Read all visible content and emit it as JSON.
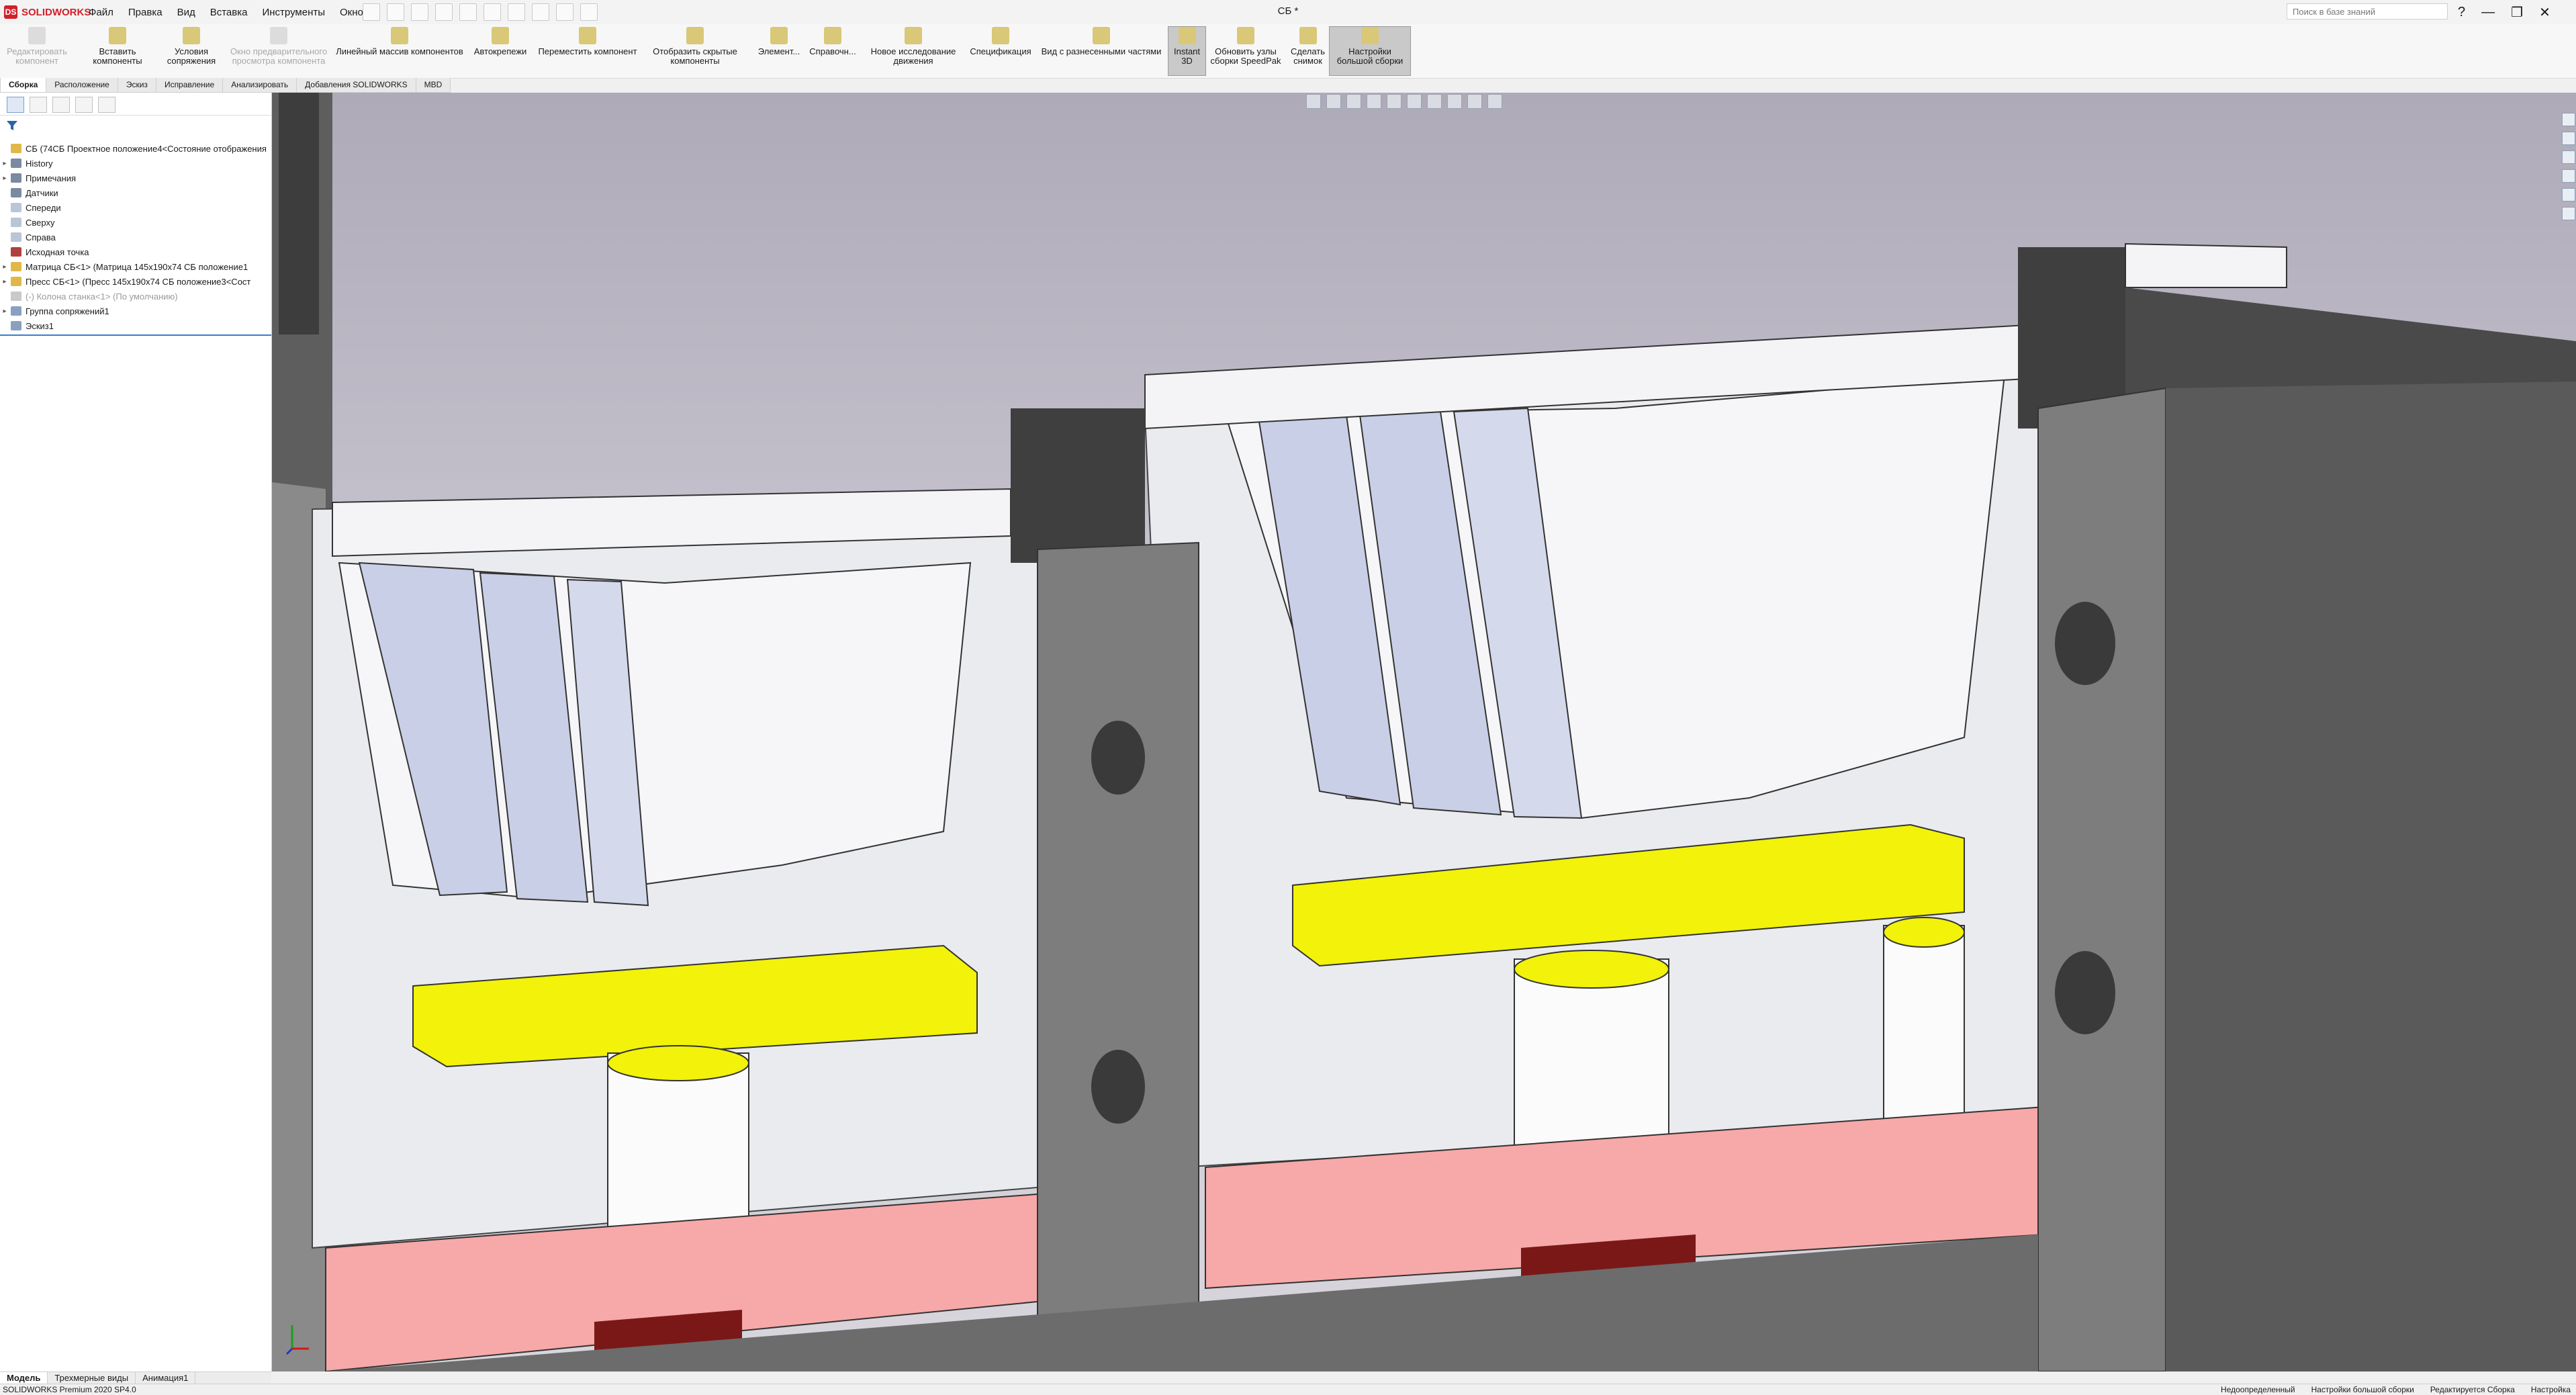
{
  "app": {
    "logo_text": "SOLIDWORKS",
    "doc_title": "СБ *"
  },
  "menu": [
    "Файл",
    "Правка",
    "Вид",
    "Вставка",
    "Инструменты",
    "Окно"
  ],
  "search": {
    "placeholder": "Поиск в базе знаний"
  },
  "window_controls": [
    "?",
    "—",
    "❐",
    "✕"
  ],
  "toolbar": [
    {
      "label": "Редактировать компонент",
      "state": "disabled",
      "icon": "edit-component-icon"
    },
    {
      "label": "Вставить компоненты",
      "state": "normal",
      "icon": "insert-components-icon"
    },
    {
      "label": "Условия сопряжения",
      "state": "normal",
      "icon": "mate-icon"
    },
    {
      "label": "Окно предварительного просмотра компонента",
      "state": "disabled",
      "icon": "preview-icon"
    },
    {
      "label": "Линейный массив компонентов",
      "state": "normal",
      "icon": "linear-pattern-icon"
    },
    {
      "label": "Автокрепежи",
      "state": "normal",
      "icon": "smart-fasteners-icon"
    },
    {
      "label": "Переместить компонент",
      "state": "normal",
      "icon": "move-component-icon"
    },
    {
      "label": "Отобразить скрытые компоненты",
      "state": "normal",
      "icon": "show-hidden-icon"
    },
    {
      "label": "Элемент...",
      "state": "normal",
      "icon": "assembly-feature-icon"
    },
    {
      "label": "Справочн...",
      "state": "normal",
      "icon": "reference-geometry-icon"
    },
    {
      "label": "Новое исследование движения",
      "state": "normal",
      "icon": "motion-study-icon"
    },
    {
      "label": "Спецификация",
      "state": "normal",
      "icon": "bom-icon"
    },
    {
      "label": "Вид с разнесенными частями",
      "state": "normal",
      "icon": "exploded-view-icon"
    },
    {
      "label": "Instant 3D",
      "state": "active",
      "icon": "instant3d-icon"
    },
    {
      "label": "Обновить узлы сборки SpeedPak",
      "state": "normal",
      "icon": "speedpak-icon"
    },
    {
      "label": "Сделать снимок",
      "state": "normal",
      "icon": "snapshot-icon"
    },
    {
      "label": "Настройки большой сборки",
      "state": "active",
      "icon": "large-assembly-icon"
    }
  ],
  "command_tabs": [
    "Сборка",
    "Расположение",
    "Эскиз",
    "Исправление",
    "Анализировать",
    "Добавления SOLIDWORKS",
    "MBD"
  ],
  "feature_tree": [
    {
      "label": "СБ  (74СБ Проектное положение4<Состояние отображения",
      "expand": "",
      "icon": "assembly-icon",
      "muted": false
    },
    {
      "label": "History",
      "expand": "▸",
      "icon": "history-icon",
      "muted": false
    },
    {
      "label": "Примечания",
      "expand": "▸",
      "icon": "annotations-icon",
      "muted": false
    },
    {
      "label": "Датчики",
      "expand": "",
      "icon": "sensors-icon",
      "muted": false
    },
    {
      "label": "Спереди",
      "expand": "",
      "icon": "plane-icon",
      "muted": false
    },
    {
      "label": "Сверху",
      "expand": "",
      "icon": "plane-icon",
      "muted": false
    },
    {
      "label": "Справа",
      "expand": "",
      "icon": "plane-icon",
      "muted": false
    },
    {
      "label": "Исходная точка",
      "expand": "",
      "icon": "origin-icon",
      "muted": false
    },
    {
      "label": "Матрица СБ<1> (Матрица 145х190х74 СБ положение1",
      "expand": "▸",
      "icon": "subassembly-icon",
      "muted": false
    },
    {
      "label": "Пресс СБ<1> (Пресс 145х190х74 СБ положение3<Сост",
      "expand": "▸",
      "icon": "subassembly-icon",
      "muted": false
    },
    {
      "label": "(-) Колона станка<1> (По умолчанию)",
      "expand": "",
      "icon": "part-icon",
      "muted": true
    },
    {
      "label": "Группа сопряжений1",
      "expand": "▸",
      "icon": "mates-icon",
      "muted": false
    },
    {
      "label": "Эскиз1",
      "expand": "",
      "icon": "sketch-icon",
      "muted": false
    }
  ],
  "bottom_tabs": [
    "Модель",
    "Трехмерные виды",
    "Анимация1"
  ],
  "status": {
    "left": "SOLIDWORKS Premium 2020 SP4.0",
    "right": [
      "Недоопределенный",
      "Настройки большой сборки",
      "Редактируется Сборка",
      "Настройка"
    ]
  },
  "colors": {
    "yellow_plate": "#f2f20a",
    "pink_base": "#f7a8a8",
    "gray_column": "#7d7d7d",
    "die_light": "#f4f5f8",
    "die_blue": "#c9cfe6",
    "accent": "#d0202a"
  }
}
